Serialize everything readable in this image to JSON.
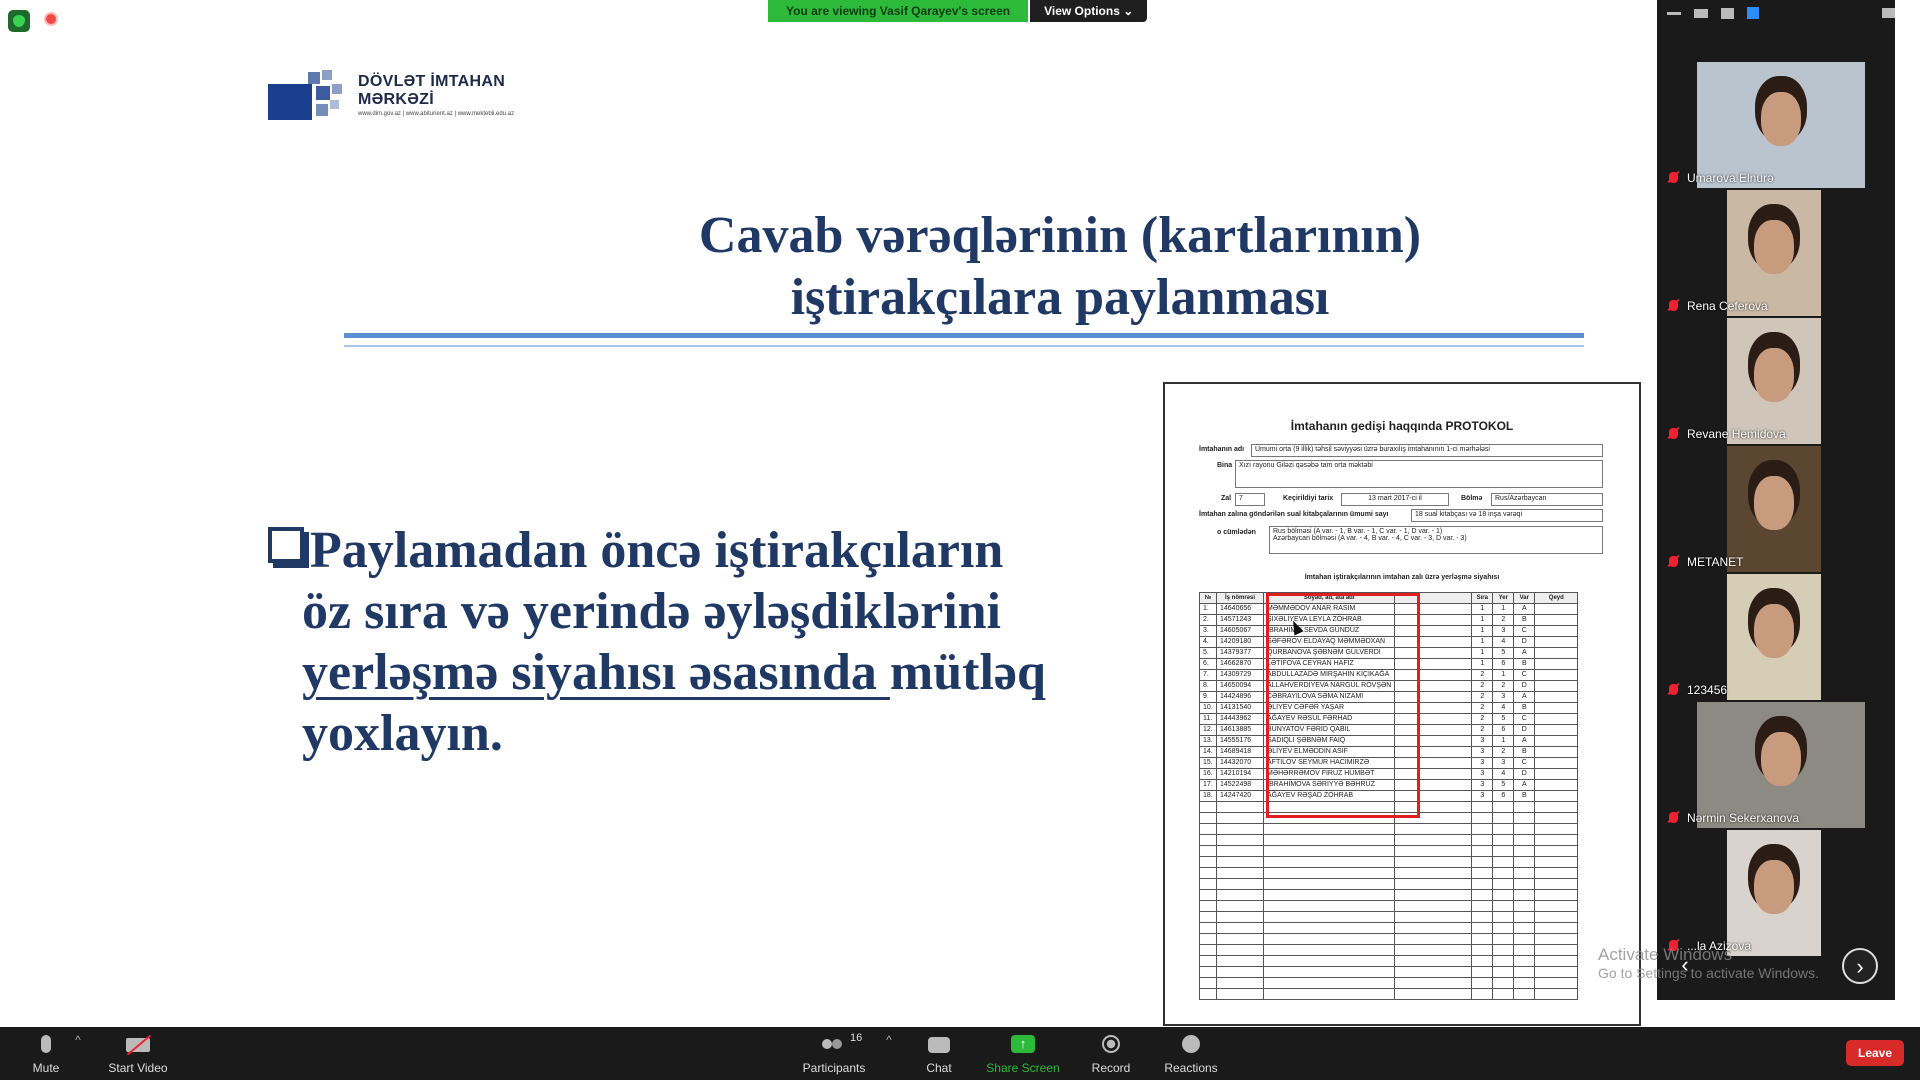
{
  "banner": {
    "message": "You are viewing Vasif Qarayev's screen",
    "options": "View Options ⌄"
  },
  "logo": {
    "line1": "DÖVLƏT İMTAHAN",
    "line2": "MƏRKƏZİ",
    "line3": "www.dim.gov.az | www.abiturient.az | www.mektebli.edu.az"
  },
  "slide": {
    "title_l1": "Cavab vərəqlərinin (kartlarının)",
    "title_l2": "iştirakçılara paylanması",
    "bullet_l1": "Paylamadan öncə iştirakçıların",
    "bullet_l2": "öz sıra və yerində əyləşdiklərini",
    "bullet_l3u": "yerləşmə siyahısı əsasında ",
    "bullet_l3": "mütləq",
    "bullet_l4": "yoxlayın."
  },
  "protocol": {
    "title": "İmtahanın gedişi haqqında PROTOKOL",
    "exam_label": "İmtahanın adı",
    "exam_value": "Ümumi orta (9 illik) təhsil səviyyəsi üzrə buraxılış imtahanının 1-ci mərhələsi",
    "bina_label": "Bina",
    "bina_value": "Xızı rayonu Giləzi qəsəbə tam orta məktəbi",
    "zal_label": "Zal",
    "zal_value": "7",
    "date_label": "Keçirildiyi tarix",
    "date_value": "13 mart 2017-ci il",
    "bolme_label": "Bölmə",
    "bolme_value": "Rus/Azərbaycan",
    "count_label": "İmtahan zalına göndərilən sual kitabçalarının ümumi sayı",
    "count_value": "18 sual kitabçası və 18 inşa vərəqi",
    "cumlə_label": "o cümlədən",
    "cumlə_v1": "Rus bölməsi (A var. - 1, B var. - 1, C var. - 1, D var. - 1)",
    "cumlə_v2": "Azərbaycan bölməsi (A var. - 4, B var. - 4, C var. - 3, D var. - 3)",
    "list_title": "İmtahan iştirakçılarının imtahan zalı üzrə yerləşmə siyahısı",
    "headers": [
      "№",
      "İş nömrəsi",
      "Soyad, ad, ata adı",
      "",
      "Sıra",
      "Yer",
      "Var",
      "Qeyd"
    ],
    "rows": [
      [
        "1.",
        "14640656",
        "MƏMMƏDOV ANAR RASİM",
        "1",
        "1",
        "A"
      ],
      [
        "2.",
        "14571243",
        "ŞIXƏLİYEVA LEYLA ZÖHRAB",
        "1",
        "2",
        "B"
      ],
      [
        "3.",
        "14605067",
        "İBRAHİMLİ SEVDA GÜNDÜZ",
        "1",
        "3",
        "C"
      ],
      [
        "4.",
        "14209180",
        "SƏFƏROV ELDAYAQ MƏMMƏDXAN",
        "1",
        "4",
        "D"
      ],
      [
        "5.",
        "14379377",
        "QURBANOVA ŞƏBNƏM GÜLVERDİ",
        "1",
        "5",
        "A"
      ],
      [
        "6.",
        "14662870",
        "LƏTİFOVA CEYRAN HAFİZ",
        "1",
        "6",
        "B"
      ],
      [
        "7.",
        "14309729",
        "ABDULLAZADƏ MİRŞAHİN KİÇİKAĞA",
        "2",
        "1",
        "C"
      ],
      [
        "8.",
        "14650094",
        "ALLAHVERDİYEVA NARGÜL RÖVŞƏN",
        "2",
        "2",
        "D"
      ],
      [
        "9.",
        "14424896",
        "CƏBRAYILOVA SƏMA NİZAMİ",
        "2",
        "3",
        "A"
      ],
      [
        "10.",
        "14131540",
        "ƏLİYEV CƏFƏR YAŞAR",
        "2",
        "4",
        "B"
      ],
      [
        "11.",
        "14443962",
        "AĞAYEV RƏSUL FƏRHAD",
        "2",
        "5",
        "C"
      ],
      [
        "12.",
        "14613885",
        "BÜNYATOV FƏRİD QABİL",
        "2",
        "6",
        "D"
      ],
      [
        "13.",
        "14555176",
        "SADIQLI ŞƏBNƏM FAİQ",
        "3",
        "1",
        "A"
      ],
      [
        "14.",
        "14689418",
        "ƏLİYEV ELMƏDDİN ASİF",
        "3",
        "2",
        "B"
      ],
      [
        "15.",
        "14432070",
        "AFTİLOV SEYMUR HACIMİRZƏ",
        "3",
        "3",
        "C"
      ],
      [
        "16.",
        "14210194",
        "MƏHƏRRƏMOV FİRUZ HÜMBƏT",
        "3",
        "4",
        "D"
      ],
      [
        "17.",
        "14522498",
        "İBRAHİMOVA SƏRİYYƏ BƏHRUZ",
        "3",
        "5",
        "A"
      ],
      [
        "18.",
        "14247420",
        "AĞAYEV RƏŞAD ZÖHRAB",
        "3",
        "6",
        "B"
      ]
    ]
  },
  "participants": [
    {
      "name": "Umarova Elnurə",
      "bg": "#b9c4cf"
    },
    {
      "name": "Rena Ceferova",
      "bg": "#c9b8a4"
    },
    {
      "name": "Revane Hemidova",
      "bg": "#cfc5b9"
    },
    {
      "name": "METANET",
      "bg": "#5b4632"
    },
    {
      "name": "123456",
      "bg": "#d6cdb6"
    },
    {
      "name": "Nərmin Sekerxanova",
      "bg": "#8d8a83"
    },
    {
      "name": "...la Azizova",
      "bg": "#d8d3cc"
    }
  ],
  "windows": {
    "line1": "Activate Windows",
    "line2": "Go to Settings to activate Windows."
  },
  "toolbar": {
    "mute": "Mute",
    "video": "Start Video",
    "participants": "Participants",
    "participants_count": "16",
    "chat": "Chat",
    "share": "Share Screen",
    "record": "Record",
    "reactions": "Reactions",
    "leave": "Leave"
  },
  "colors": {
    "accent_green": "#2dba3a",
    "title_navy": "#1f3864",
    "leave_red": "#d92a2a",
    "highlight_red": "#e02020"
  }
}
